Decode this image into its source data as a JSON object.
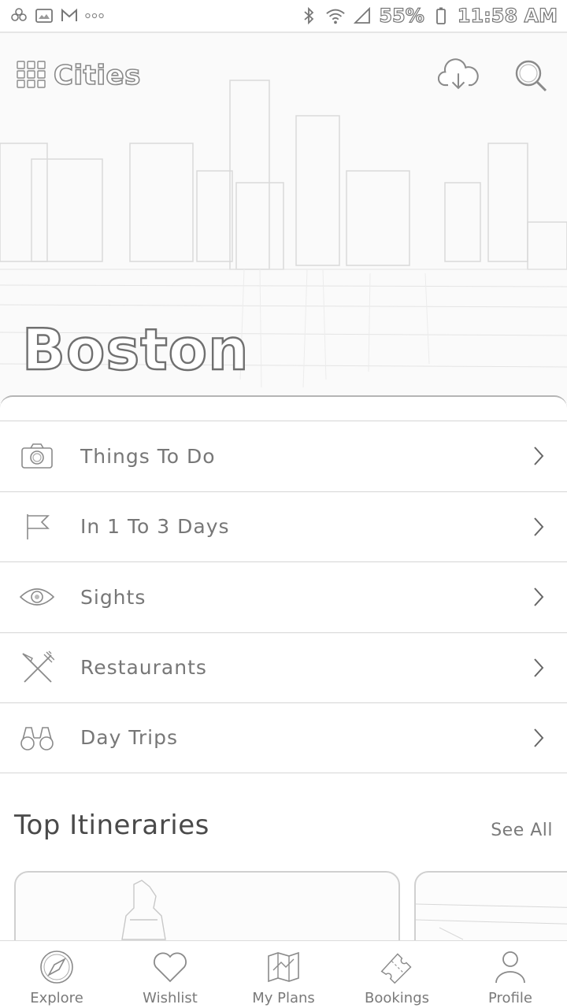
{
  "status_bar": {
    "left_icons": [
      "pinwheel-icon",
      "image-icon",
      "gmail-icon",
      "more-dots-icon"
    ],
    "battery_percent": "55%",
    "time": "11:58 AM"
  },
  "header": {
    "title": "Cities",
    "menu_icon": "grid-menu-icon",
    "actions": [
      "cloud-download-icon",
      "search-icon"
    ]
  },
  "hero": {
    "city": "Boston"
  },
  "menu": {
    "items": [
      {
        "label": "Things To Do",
        "icon": "camera-icon"
      },
      {
        "label": "In 1 To 3 Days",
        "icon": "flag-icon"
      },
      {
        "label": "Sights",
        "icon": "eye-icon"
      },
      {
        "label": "Restaurants",
        "icon": "fork-knife-icon"
      },
      {
        "label": "Day Trips",
        "icon": "binoculars-icon"
      }
    ]
  },
  "itineraries": {
    "title": "Top Itineraries",
    "see_all": "See All"
  },
  "bottom_nav": {
    "items": [
      {
        "label": "Explore",
        "icon": "compass-icon"
      },
      {
        "label": "Wishlist",
        "icon": "heart-icon"
      },
      {
        "label": "My Plans",
        "icon": "map-icon"
      },
      {
        "label": "Bookings",
        "icon": "ticket-icon"
      },
      {
        "label": "Profile",
        "icon": "person-icon"
      }
    ]
  },
  "colors": {
    "line": "#8a8a8a",
    "text": "#777777",
    "divider": "#d5d5d5"
  }
}
